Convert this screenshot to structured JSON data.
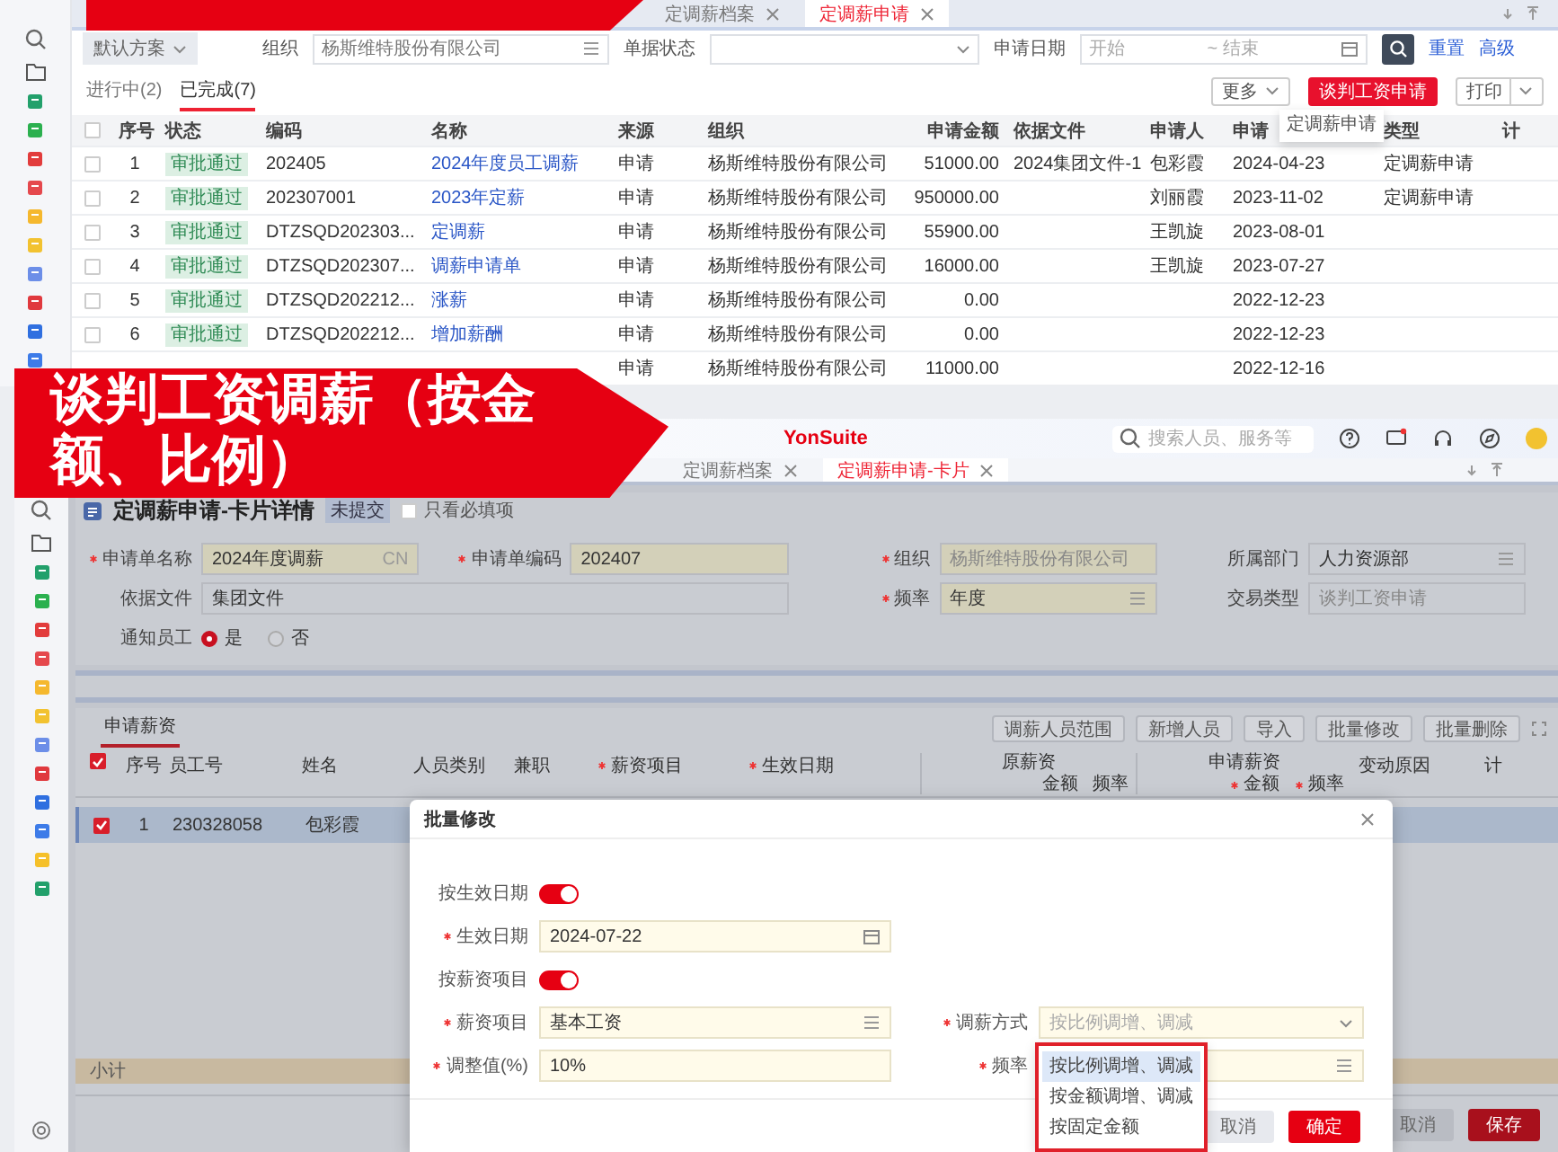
{
  "top_window": {
    "tabs": [
      {
        "label": "定调薪档案",
        "selected": false
      },
      {
        "label": "定调薪申请",
        "selected": true
      }
    ],
    "filters": {
      "scheme": "默认方案",
      "org_label": "组织",
      "org_value": "杨斯维特股份有限公司",
      "status_label": "单据状态",
      "date_label": "申请日期",
      "date_start_placeholder": "开始",
      "date_end_placeholder": "~ 结束",
      "reset": "重置",
      "advanced": "高级"
    },
    "status_tabs": [
      {
        "label": "进行中(2)",
        "selected": false
      },
      {
        "label": "已完成(7)",
        "selected": true
      }
    ],
    "toolbar": {
      "more": "更多",
      "primary": "谈判工资申请",
      "print": "打印"
    },
    "more_menu": [
      "定调薪申请"
    ],
    "table": {
      "all_checked": false,
      "columns": [
        {
          "kind": "number",
          "label": "序号"
        },
        {
          "kind": "badge",
          "label": "状态"
        },
        {
          "kind": "text",
          "label": "编码"
        },
        {
          "kind": "link",
          "label": "名称"
        },
        {
          "kind": "text",
          "label": "来源"
        },
        {
          "kind": "text",
          "label": "组织"
        },
        {
          "kind": "amount",
          "label": "申请金额"
        },
        {
          "kind": "text",
          "label": "依据文件"
        },
        {
          "kind": "text",
          "label": "申请人"
        },
        {
          "kind": "text",
          "label": "申请"
        },
        {
          "kind": "text",
          "label": "类型"
        },
        {
          "kind": "text",
          "label": "计"
        }
      ],
      "rows": [
        {
          "checked": false,
          "cells": [
            "1",
            "审批通过",
            "202405",
            "2024年度员工调薪",
            "申请",
            "杨斯维特股份有限公司",
            "51000.00",
            "2024集团文件-1",
            "包彩霞",
            "2024-04-23",
            "定调薪申请",
            null
          ]
        },
        {
          "checked": false,
          "cells": [
            "2",
            "审批通过",
            "202307001",
            "2023年定薪",
            "申请",
            "杨斯维特股份有限公司",
            "950000.00",
            null,
            "刘丽霞",
            "2023-11-02",
            "定调薪申请",
            null
          ]
        },
        {
          "checked": false,
          "cells": [
            "3",
            "审批通过",
            "DTZSQD202303...",
            "定调薪",
            "申请",
            "杨斯维特股份有限公司",
            "55900.00",
            null,
            "王凯旋",
            "2023-08-01",
            null,
            null
          ]
        },
        {
          "checked": false,
          "cells": [
            "4",
            "审批通过",
            "DTZSQD202307...",
            "调薪申请单",
            "申请",
            "杨斯维特股份有限公司",
            "16000.00",
            null,
            "王凯旋",
            "2023-07-27",
            null,
            null
          ]
        },
        {
          "checked": false,
          "cells": [
            "5",
            "审批通过",
            "DTZSQD202212...",
            "涨薪",
            "申请",
            "杨斯维特股份有限公司",
            "0.00",
            null,
            null,
            "2022-12-23",
            null,
            null
          ]
        },
        {
          "checked": false,
          "cells": [
            "6",
            "审批通过",
            "DTZSQD202212...",
            "增加薪酬",
            "申请",
            "杨斯维特股份有限公司",
            "0.00",
            null,
            null,
            "2022-12-23",
            null,
            null
          ]
        },
        {
          "cells": [
            null,
            null,
            null,
            null,
            "申请",
            "杨斯维特股份有限公司",
            "11000.00",
            null,
            null,
            "2022-12-16",
            null,
            null
          ]
        }
      ]
    }
  },
  "banner": {
    "text": "谈判工资调薪（按金额、比例）"
  },
  "bottom_window": {
    "header": {
      "logo": "YonSuite",
      "search_placeholder": "搜索人员、服务等"
    },
    "tabs": [
      {
        "label": "定调薪档案",
        "selected": false
      },
      {
        "label": "定调薪申请-卡片",
        "selected": true
      }
    ],
    "card": {
      "title": "定调薪申请-卡片详情",
      "badge": "未提交",
      "required_only": {
        "label": "只看必填项",
        "checked": false
      }
    },
    "form": [
      {
        "kind": "text",
        "label": "申请单名称",
        "required": true,
        "disabled": false,
        "value": "2024年度调薪",
        "suffix": "CN"
      },
      {
        "kind": "text",
        "label": "申请单编码",
        "required": true,
        "disabled": false,
        "value": "202407"
      },
      {
        "kind": "text",
        "label": "组织",
        "required": true,
        "disabled": true,
        "value": "杨斯维特股份有限公司"
      },
      {
        "kind": "ref",
        "label": "所属部门",
        "required": false,
        "disabled": false,
        "value": "人力资源部"
      },
      {
        "kind": "long_text",
        "label": "依据文件",
        "required": false,
        "disabled": false,
        "value": "集团文件"
      },
      {
        "kind": "ref",
        "label": "频率",
        "required": true,
        "disabled": false,
        "value": "年度"
      },
      {
        "kind": "text",
        "label": "交易类型",
        "required": false,
        "disabled": true,
        "value": "谈判工资申请"
      },
      {
        "kind": "radio",
        "label": "通知员工",
        "options": [
          {
            "label": "是",
            "selected": true
          },
          {
            "label": "否",
            "selected": false
          }
        ]
      }
    ],
    "section_tab": {
      "label": "申请薪资",
      "selected": true
    },
    "actions": [
      "调薪人员范围",
      "新增人员",
      "导入",
      "批量修改",
      "批量删除"
    ],
    "table": {
      "all_checked": true,
      "columns": [
        {
          "label": "序号",
          "required": false
        },
        {
          "label": "员工号",
          "required": false
        },
        {
          "label": "姓名",
          "required": false
        },
        {
          "label": "人员类别",
          "required": false
        },
        {
          "label": "兼职",
          "required": false
        },
        {
          "label": "薪资项目",
          "required": true
        },
        {
          "label": "生效日期",
          "required": true
        },
        {
          "label": "原薪资",
          "required": false,
          "children": [
            {
              "label": "金额",
              "required": false
            },
            {
              "label": "频率",
              "required": false
            }
          ]
        },
        {
          "label": "申请薪资",
          "required": false,
          "children": [
            {
              "label": "金额",
              "required": true
            },
            {
              "label": "频率",
              "required": true
            }
          ]
        },
        {
          "label": "变动原因",
          "required": false
        },
        {
          "label": "计",
          "required": false
        }
      ],
      "rows": [
        {
          "checked": true,
          "selected": true,
          "cells": [
            "1",
            "230328058",
            "包彩霞"
          ]
        }
      ],
      "subtotal_label": "小计"
    },
    "footer": [
      {
        "label": "取消",
        "kind": "default"
      },
      {
        "label": "保存",
        "kind": "primary"
      }
    ],
    "modal": {
      "title": "批量修改",
      "fields": [
        {
          "kind": "switch",
          "label": "按生效日期",
          "on": true
        },
        {
          "kind": "date",
          "label": "生效日期",
          "required": true,
          "value": "2024-07-22"
        },
        {
          "kind": "switch",
          "label": "按薪资项目",
          "on": true
        },
        {
          "kind": "ref",
          "label": "薪资项目",
          "required": true,
          "value": "基本工资"
        },
        {
          "kind": "text",
          "label": "调整值(%)",
          "required": true,
          "value": "10%"
        }
      ],
      "right_fields": [
        {
          "kind": "select",
          "label": "调薪方式",
          "required": true,
          "placeholder": "按比例调增、调减"
        },
        {
          "kind": "ref",
          "label": "频率",
          "required": true
        }
      ],
      "options": [
        {
          "label": "按比例调增、调减",
          "selected": true
        },
        {
          "label": "按金额调增、调减",
          "selected": false
        },
        {
          "label": "按固定金额",
          "selected": false
        }
      ],
      "buttons": [
        {
          "label": "取消",
          "kind": "default"
        },
        {
          "label": "确定",
          "kind": "primary"
        }
      ]
    }
  }
}
